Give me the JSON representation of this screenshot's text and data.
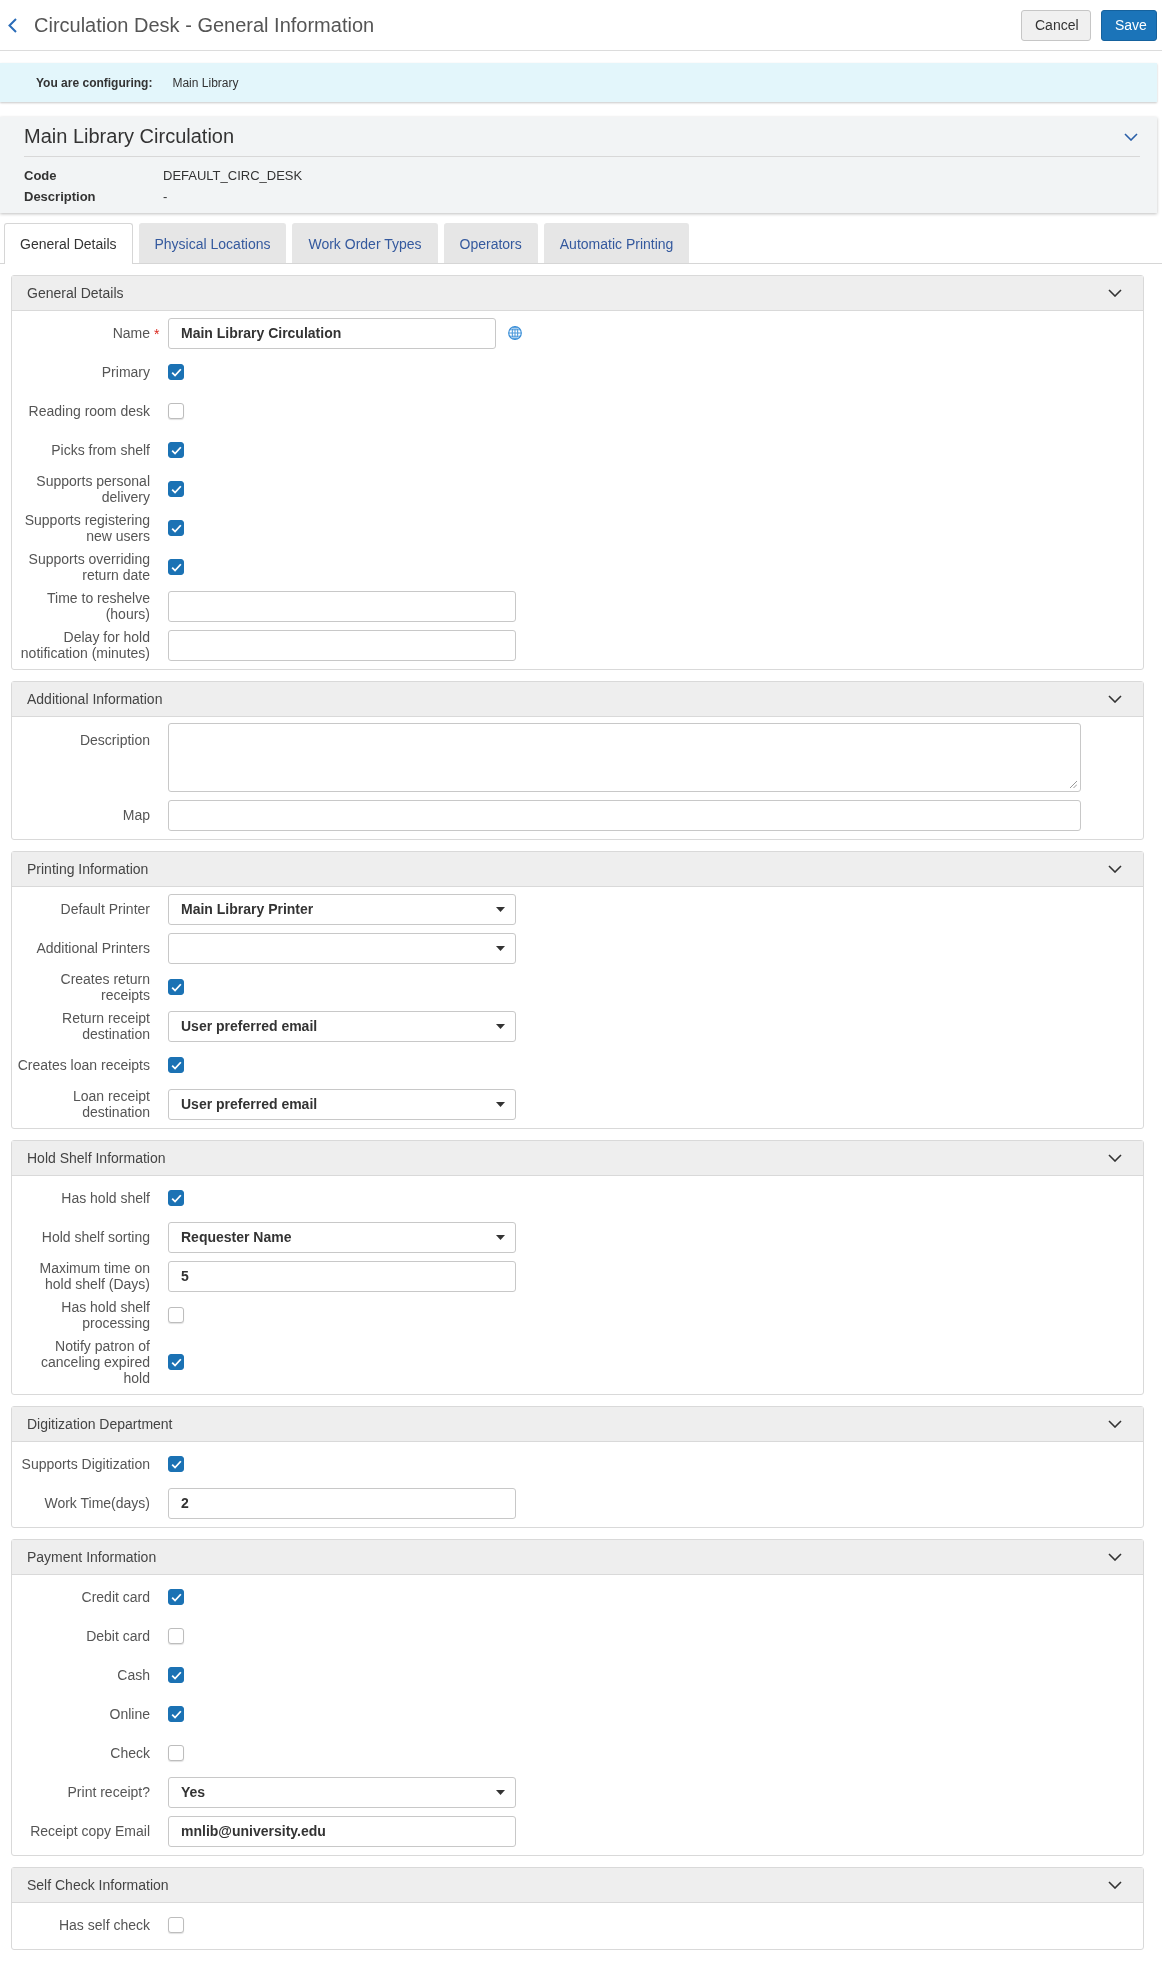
{
  "header": {
    "title": "Circulation Desk - General Information",
    "buttons": [
      {
        "label": "Cancel",
        "kind": "cancel"
      },
      {
        "label": "Save",
        "kind": "save"
      }
    ]
  },
  "context_bar": {
    "label": "You are configuring:",
    "value": "Main Library"
  },
  "summary": {
    "title": "Main Library Circulation",
    "expanded": true,
    "fields": [
      {
        "label": "Code",
        "value": "DEFAULT_CIRC_DESK"
      },
      {
        "label": "Description",
        "value": "-"
      }
    ]
  },
  "tabs": [
    {
      "label": "General Details",
      "selected": true
    },
    {
      "label": "Physical Locations",
      "selected": false
    },
    {
      "label": "Work Order Types",
      "selected": false
    },
    {
      "label": "Operators",
      "selected": false
    },
    {
      "label": "Automatic Printing",
      "selected": false
    }
  ],
  "sections": [
    {
      "title": "General Details",
      "expanded": true,
      "fields": [
        {
          "kind": "localized",
          "label": "Name",
          "required_mark": "*",
          "value": "Main Library Circulation"
        },
        {
          "kind": "checkbox",
          "label": "Primary",
          "checked": true
        },
        {
          "kind": "checkbox",
          "label": "Reading room desk",
          "checked": false
        },
        {
          "kind": "checkbox",
          "label": "Picks from shelf",
          "checked": true
        },
        {
          "kind": "checkbox",
          "label": "Supports personal delivery",
          "checked": true
        },
        {
          "kind": "checkbox",
          "label": "Supports registering new users",
          "checked": true
        },
        {
          "kind": "checkbox",
          "label": "Supports overriding return date",
          "checked": true
        },
        {
          "kind": "text",
          "label": "Time to reshelve (hours)"
        },
        {
          "kind": "text",
          "label": "Delay for hold notification (minutes)"
        }
      ]
    },
    {
      "title": "Additional Information",
      "expanded": true,
      "fields": [
        {
          "kind": "textarea",
          "label": "Description"
        },
        {
          "kind": "widetext",
          "label": "Map"
        }
      ]
    },
    {
      "title": "Printing Information",
      "expanded": true,
      "fields": [
        {
          "kind": "select",
          "label": "Default Printer",
          "value": "Main Library Printer"
        },
        {
          "kind": "select",
          "label": "Additional Printers"
        },
        {
          "kind": "checkbox",
          "label": "Creates return receipts",
          "checked": true
        },
        {
          "kind": "select",
          "label": "Return receipt destination",
          "value": "User preferred email"
        },
        {
          "kind": "checkbox",
          "label": "Creates loan receipts",
          "checked": true
        },
        {
          "kind": "select",
          "label": "Loan receipt destination",
          "value": "User preferred email"
        }
      ]
    },
    {
      "title": "Hold Shelf Information",
      "expanded": true,
      "fields": [
        {
          "kind": "checkbox",
          "label": "Has hold shelf",
          "checked": true
        },
        {
          "kind": "select",
          "label": "Hold shelf sorting",
          "value": "Requester Name"
        },
        {
          "kind": "text",
          "label": "Maximum time on hold shelf (Days)",
          "value": "5"
        },
        {
          "kind": "checkbox",
          "label": "Has hold shelf processing",
          "checked": false
        },
        {
          "kind": "checkbox",
          "label": "Notify patron of canceling expired hold",
          "checked": true
        }
      ]
    },
    {
      "title": "Digitization Department",
      "expanded": true,
      "fields": [
        {
          "kind": "checkbox",
          "label": "Supports Digitization",
          "checked": true
        },
        {
          "kind": "text",
          "label": "Work Time(days)",
          "value": "2"
        }
      ]
    },
    {
      "title": "Payment Information",
      "expanded": true,
      "fields": [
        {
          "kind": "checkbox",
          "label": "Credit card",
          "checked": true
        },
        {
          "kind": "checkbox",
          "label": "Debit card",
          "checked": false
        },
        {
          "kind": "checkbox",
          "label": "Cash",
          "checked": true
        },
        {
          "kind": "checkbox",
          "label": "Online",
          "checked": true
        },
        {
          "kind": "checkbox",
          "label": "Check",
          "checked": false
        },
        {
          "kind": "select",
          "label": "Print receipt?",
          "value": "Yes"
        },
        {
          "kind": "text",
          "label": "Receipt copy Email",
          "value": "mnlib@university.edu"
        }
      ]
    },
    {
      "title": "Self Check Information",
      "expanded": true,
      "fields": [
        {
          "kind": "checkbox",
          "label": "Has self check",
          "checked": false
        }
      ]
    }
  ]
}
